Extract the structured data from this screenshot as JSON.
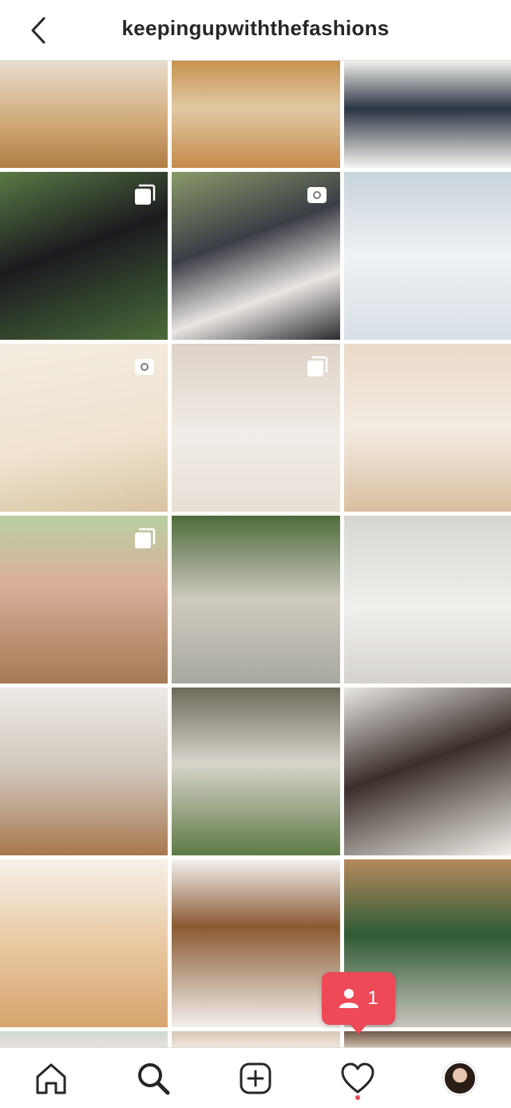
{
  "header": {
    "username": "keepingupwiththefashions"
  },
  "notification": {
    "count": "1"
  },
  "grid": {
    "tiles": [
      {
        "bg": "linear-gradient(180deg,#e9ddcf 0%,#cfa774 60%,#b07c45 100%)",
        "badge": "none"
      },
      {
        "bg": "linear-gradient(180deg,#c6924f 0%,#e0c9a4 45%,#c48a4a 100%)",
        "badge": "none"
      },
      {
        "bg": "linear-gradient(180deg,#f2f2ee 0%,#2b3442 45%,#f5f4f0 100%)",
        "badge": "none"
      },
      {
        "bg": "linear-gradient(160deg,#5a7a46 0%,#1b1b1f 45%,#4a6b3a 100%)",
        "badge": "multi"
      },
      {
        "bg": "linear-gradient(160deg,#8a9a6a 0%,#3b3d46 40%,#e9e5e2 70%,#2a2a2e 100%)",
        "badge": "video"
      },
      {
        "bg": "linear-gradient(180deg,#c9d3db 0%,#eef2f5 50%,#d8e0e6 100%)",
        "badge": "none"
      },
      {
        "bg": "linear-gradient(170deg,#f4ede2 0%,#efe3cf 60%,#d8c3a2 100%)",
        "badge": "video"
      },
      {
        "bg": "linear-gradient(180deg,#ddd2c7 0%,#f2ede8 55%,#e7dfd6 100%)",
        "badge": "multi"
      },
      {
        "bg": "linear-gradient(180deg,#ead9c7 0%,#f3ece4 50%,#d9bfa0 100%)",
        "badge": "none"
      },
      {
        "bg": "linear-gradient(180deg,#b9cfa2 0%,#d9b09a 40%,#a57a55 100%)",
        "badge": "multi"
      },
      {
        "bg": "linear-gradient(180deg,#4e6b3b 0%,#cfcac0 50%,#a8a8a0 100%)",
        "badge": "none"
      },
      {
        "bg": "linear-gradient(180deg,#d8d6d2 0%,#f1efec 55%,#d6d3cf 100%)",
        "badge": "none"
      },
      {
        "bg": "linear-gradient(180deg,#eeeae6 0%,#cfc6bb 50%,#a8784f 100%)",
        "badge": "none"
      },
      {
        "bg": "linear-gradient(180deg,#6b6a5a 0%,#d8d4cc 45%,#5e7a45 100%)",
        "badge": "none"
      },
      {
        "bg": "linear-gradient(160deg,#eae8e4 0%,#3a2e2a 45%,#f2efe9 100%)",
        "badge": "none"
      },
      {
        "bg": "linear-gradient(180deg,#f6f1ea 0%,#e9c9a2 50%,#d6a46e 100%)",
        "badge": "none"
      },
      {
        "bg": "linear-gradient(180deg,#f3f1ee 0%,#8a5a32 40%,#f2efec 100%)",
        "badge": "none"
      },
      {
        "bg": "linear-gradient(180deg,#b58a5e 0%,#2f5a34 45%,#c9c5be 100%)",
        "badge": "none"
      },
      {
        "bg": "linear-gradient(180deg,#cfd9d2 0%,#e6e1d9 100%)",
        "badge": "none"
      },
      {
        "bg": "linear-gradient(180deg,#d8c8b6 0%,#efe6dc 100%)",
        "badge": "none"
      },
      {
        "bg": "linear-gradient(180deg,#6e5a48 0%,#cbbba8 100%)",
        "badge": "none"
      }
    ]
  },
  "nav": {
    "items": [
      {
        "icon": "home-icon"
      },
      {
        "icon": "search-icon"
      },
      {
        "icon": "new-post-icon"
      },
      {
        "icon": "heart-icon"
      },
      {
        "icon": "profile-avatar"
      }
    ]
  }
}
